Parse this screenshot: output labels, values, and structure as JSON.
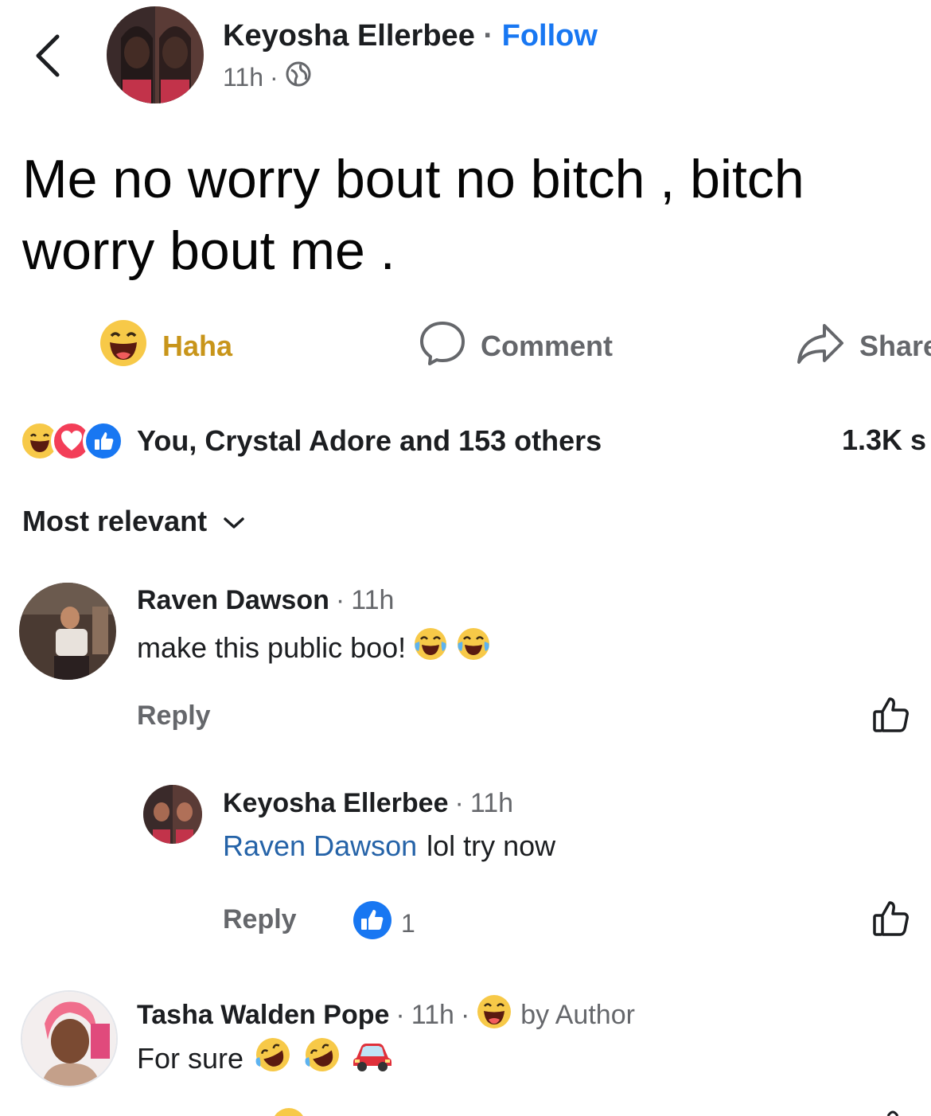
{
  "post": {
    "author": "Keyosha Ellerbee",
    "follow_separator": "·",
    "follow_label": "Follow",
    "time": "11h",
    "meta_separator": "·",
    "text": "Me no worry bout no bitch , bitch worry bout me ."
  },
  "actions": {
    "haha_label": "Haha",
    "comment_label": "Comment",
    "share_label": "Share"
  },
  "reactions": {
    "names": "You, Crystal Adore and 153 others",
    "shares": "1.3K s"
  },
  "sort": {
    "label": "Most relevant"
  },
  "comments": [
    {
      "author": "Raven Dawson",
      "separator": "·",
      "time": "11h",
      "text": "make this public boo!",
      "reply_label": "Reply"
    },
    {
      "author": "Keyosha Ellerbee",
      "separator": "·",
      "time": "11h",
      "mention": "Raven Dawson",
      "text": "lol try now",
      "reply_label": "Reply",
      "like_count": "1"
    },
    {
      "author": "Tasha Walden Pope",
      "separator": "·",
      "time": "11h",
      "separator2": "·",
      "badge": "by Author",
      "text": "For sure"
    }
  ],
  "colors": {
    "link_blue": "#1877f2",
    "mention_blue": "#2563a8",
    "haha_yellow": "#f7c948",
    "love_red": "#f33e58",
    "like_blue": "#1877f2",
    "muted": "#65676b"
  }
}
